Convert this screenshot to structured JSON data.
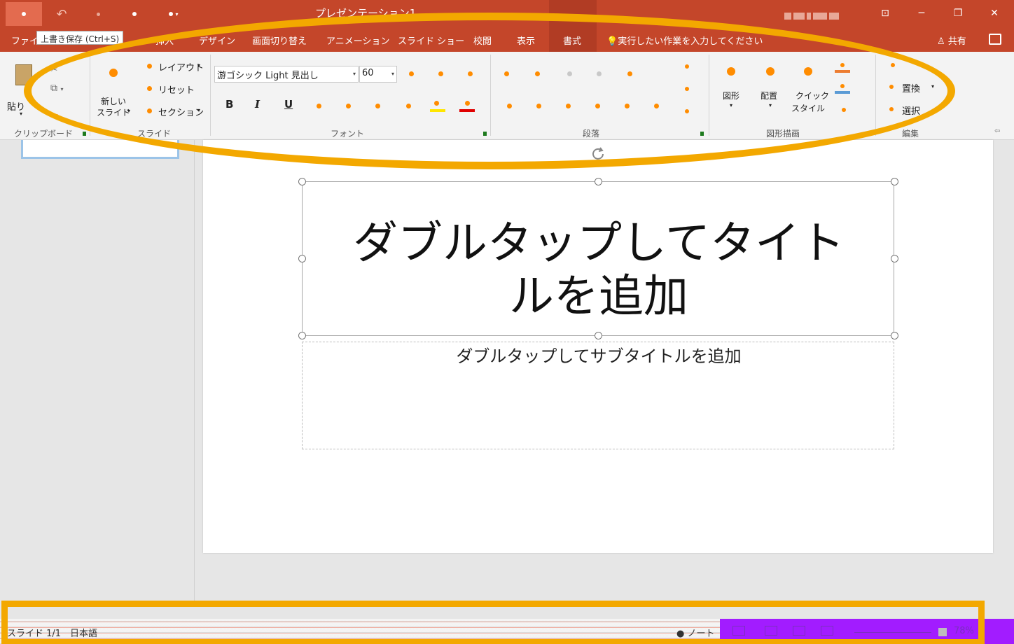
{
  "title_bar": {
    "doc_title": "プレゼンテーション1",
    "window_controls": [
      "⊡",
      "─",
      "❐",
      "✕"
    ]
  },
  "tabs": [
    "ファイル",
    "挿入",
    "デザイン",
    "画面切り替え",
    "アニメーション",
    "スライド ショー",
    "校閲",
    "表示",
    "書式"
  ],
  "active_tab": "書式",
  "tooltip": "上書き保存 (Ctrl+S)",
  "tell_me": "実行したい作業を入力してください",
  "share": "共有",
  "ribbon": {
    "clipboard": {
      "paste_label": "貼り",
      "group_label": "クリップボード"
    },
    "slides": {
      "new_slide_line1": "新しい",
      "new_slide_line2": "スライド",
      "layout": "レイアウト",
      "reset": "リセット",
      "section": "セクション",
      "group_label": "スライド"
    },
    "font": {
      "font_name": "游ゴシック Light 見出し",
      "font_size": "60",
      "bold": "B",
      "italic": "I",
      "underline": "U",
      "group_label": "フォント",
      "highlight_color": "#ffe600",
      "font_color": "#e00000"
    },
    "paragraph": {
      "group_label": "段落"
    },
    "drawing": {
      "shapes": "図形",
      "arrange": "配置",
      "quick_styles_line1": "クイック",
      "quick_styles_line2": "スタイル",
      "group_label": "図形描画",
      "fill_color": "#ed7d31",
      "line_color": "#5b9bd5"
    },
    "editing": {
      "replace": "置換",
      "select": "選択",
      "group_label": "編集"
    }
  },
  "slide": {
    "title_line1": "ダブルタップしてタイト",
    "title_line2": "ルを追加",
    "subtitle": "ダブルタップしてサブタイトルを追加"
  },
  "status": {
    "slide_count": "スライド 1/1",
    "language": "日本語",
    "notes": "ノート",
    "zoom": "78%"
  }
}
